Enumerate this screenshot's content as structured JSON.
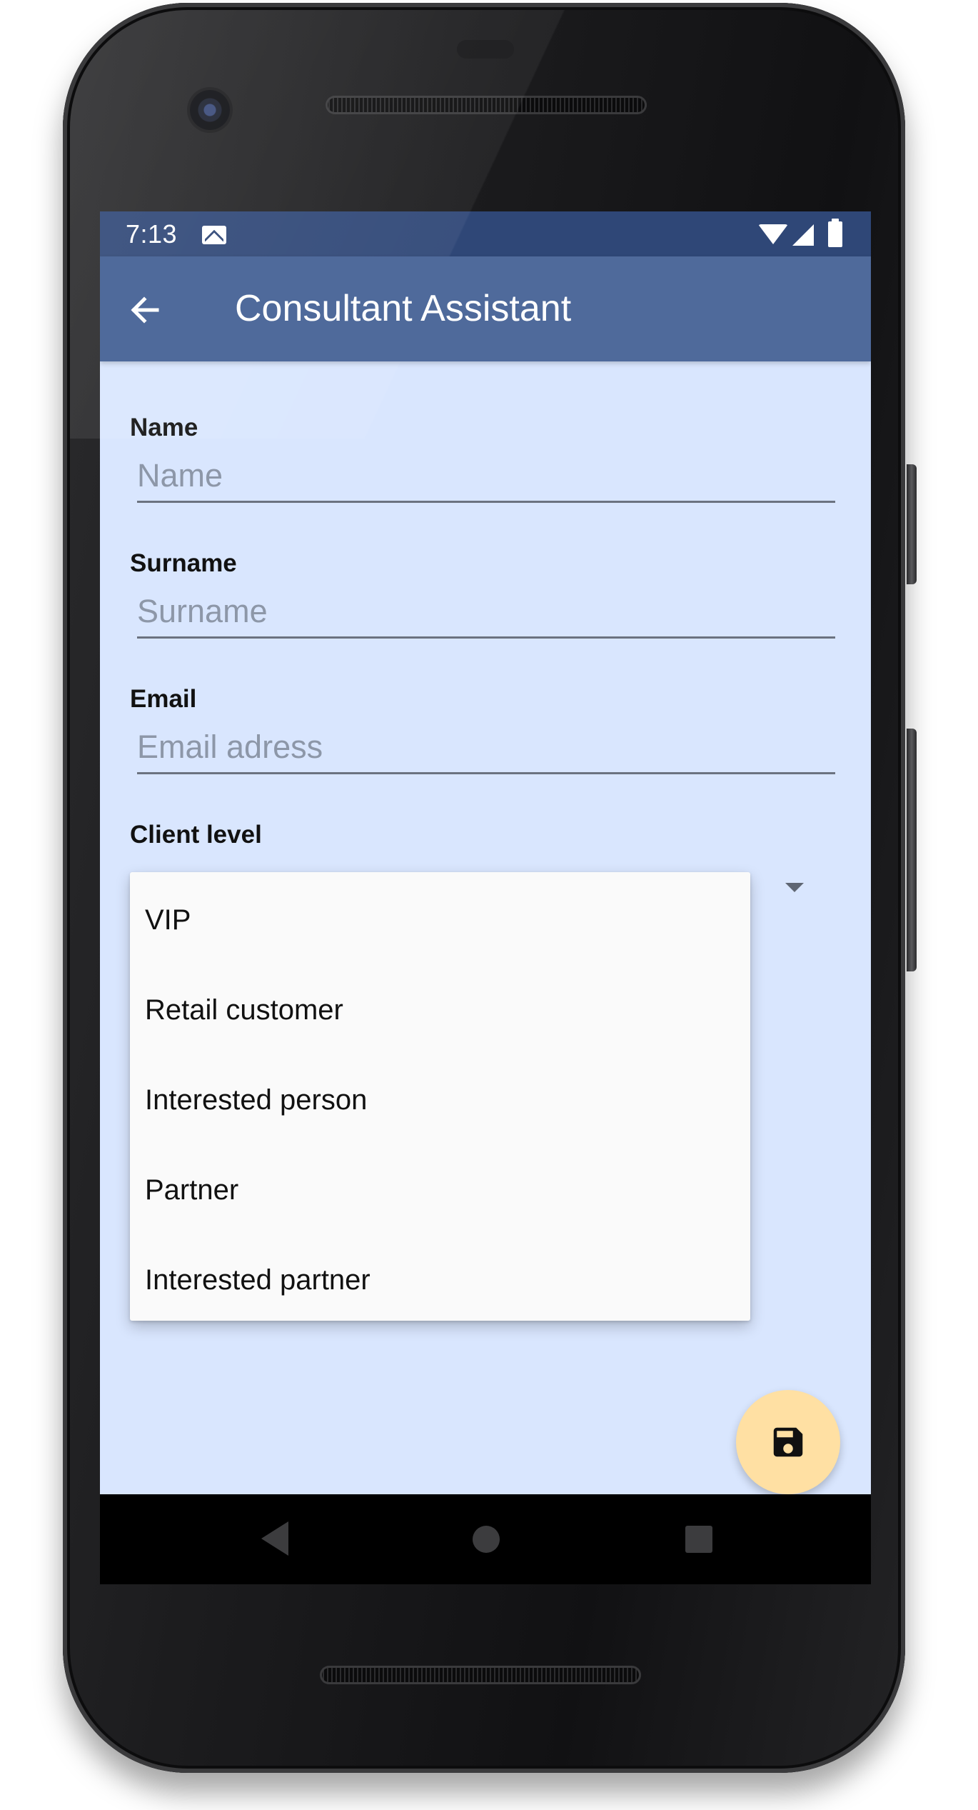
{
  "status_bar": {
    "time": "7:13",
    "icons": [
      "mail-icon",
      "wifi-icon",
      "signal-icon",
      "battery-icon"
    ]
  },
  "app_bar": {
    "title": "Consultant Assistant",
    "back_icon": "arrow-back-icon"
  },
  "form": {
    "name": {
      "label": "Name",
      "placeholder": "Name",
      "value": ""
    },
    "surname": {
      "label": "Surname",
      "placeholder": "Surname",
      "value": ""
    },
    "email": {
      "label": "Email",
      "placeholder": "Email adress",
      "value": ""
    },
    "client_level": {
      "label": "Client level",
      "options": [
        "VIP",
        "Retail customer",
        "Interested person",
        "Partner",
        "Interested partner"
      ]
    }
  },
  "fab": {
    "icon": "save-icon"
  },
  "nav_bar": {
    "icons": [
      "nav-back-icon",
      "nav-home-icon",
      "nav-recents-icon"
    ]
  },
  "colors": {
    "status_bar": "#2f4777",
    "app_bar": "#4f6a9b",
    "background": "#d9e6fe",
    "fab": "#ffe0a3",
    "dropdown": "#fafafa"
  }
}
